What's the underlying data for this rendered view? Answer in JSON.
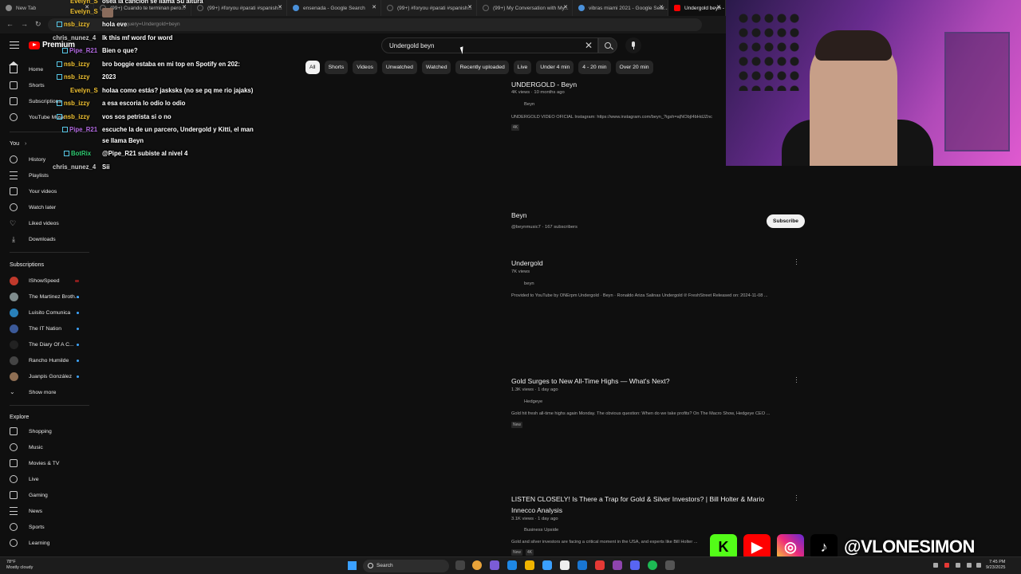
{
  "browser": {
    "tabs": [
      {
        "label": "New Tab",
        "favicon": "chrome-icon"
      },
      {
        "label": "(99+) Cuando te terminan pero...",
        "favicon": "tiktok-icon"
      },
      {
        "label": "(99+) #foryou #parati #spanish...",
        "favicon": "tiktok-icon"
      },
      {
        "label": "ensenada - Google Search",
        "favicon": "google-icon"
      },
      {
        "label": "(99+) #foryou #parati #spanish...",
        "favicon": "tiktok-icon"
      },
      {
        "label": "(99+) My Conversation with My...",
        "favicon": "tiktok-icon"
      },
      {
        "label": "vibras miami 2021 - Google Sear...",
        "favicon": "google-icon"
      },
      {
        "label": "Undergold beyn - YouTube",
        "favicon": "youtube-icon"
      }
    ],
    "url": "...h_query=Undergold+beyn"
  },
  "youtube": {
    "logo_text": "Premium",
    "search": {
      "query": "Undergold beyn"
    },
    "chips": [
      "All",
      "Shorts",
      "Videos",
      "Unwatched",
      "Watched",
      "Recently uploaded",
      "Live",
      "Under 4 min",
      "4 - 20 min",
      "Over 20 min"
    ],
    "sidebar": {
      "main": [
        {
          "label": "Home",
          "icon": "home-icon"
        },
        {
          "label": "Shorts",
          "icon": "shorts-icon"
        },
        {
          "label": "Subscriptions",
          "icon": "subscriptions-icon"
        },
        {
          "label": "YouTube Music",
          "icon": "youtube-music-icon"
        }
      ],
      "you_header": "You",
      "you": [
        {
          "label": "History",
          "icon": "history-icon"
        },
        {
          "label": "Playlists",
          "icon": "playlists-icon"
        },
        {
          "label": "Your videos",
          "icon": "your-videos-icon"
        },
        {
          "label": "Watch later",
          "icon": "watch-later-icon"
        },
        {
          "label": "Liked videos",
          "icon": "liked-icon"
        },
        {
          "label": "Downloads",
          "icon": "download-icon"
        }
      ],
      "subscriptions_header": "Subscriptions",
      "subscriptions": [
        {
          "label": "IShowSpeed",
          "color": "#c0392b"
        },
        {
          "label": "The Martinez Broth...",
          "color": "#7f8c8d"
        },
        {
          "label": "Luisito Comunica",
          "color": "#2980b9"
        },
        {
          "label": "The IT Nation",
          "color": "#3b5998"
        },
        {
          "label": "The Diary Of A C...",
          "color": "#222222"
        },
        {
          "label": "Rancho Humilde",
          "color": "#444444"
        },
        {
          "label": "Juanpis González",
          "color": "#8e6e53"
        }
      ],
      "show_more": "Show more",
      "explore_header": "Explore",
      "explore": [
        {
          "label": "Shopping",
          "icon": "shopping-icon"
        },
        {
          "label": "Music",
          "icon": "music-icon"
        },
        {
          "label": "Movies & TV",
          "icon": "movies-icon"
        },
        {
          "label": "Live",
          "icon": "live-icon"
        },
        {
          "label": "Gaming",
          "icon": "gaming-icon"
        },
        {
          "label": "News",
          "icon": "news-icon"
        },
        {
          "label": "Sports",
          "icon": "sports-icon"
        },
        {
          "label": "Learning",
          "icon": "learning-icon"
        }
      ]
    },
    "results": [
      {
        "title": "UNDERGOLD - Beyn",
        "meta": "4K views · 10 months ago",
        "channel": "Beyn",
        "desc": "UNDERGOLD VIDEO OFICIAL Instagram: https://www.instagram.com/beyn_?igsh=a|NObjI4bHdJZnc",
        "tag": "4K"
      },
      {
        "title": "Beyn",
        "meta": "@beynmusic7 · 167 subscribers",
        "subscribe_label": "Subscribe"
      },
      {
        "title": "Undergold",
        "meta": "7K views",
        "channel": "beyn",
        "desc": "Provided to YouTube by ONErpm Undergold · Beyn · Ronaldo Ariza Salinas Undergold ℗ FreshStreet Released on: 2024-11-08 ..."
      },
      {
        "title": "Gold Surges to New All-Time Highs — What's Next?",
        "meta": "1.3K views · 1 day ago",
        "channel": "Hedgeye",
        "desc": "Gold hit fresh all-time highs again Monday. The obvious question: When do we take profits? On The Macro Show, Hedgeye CEO ...",
        "tag": "New"
      },
      {
        "title": "LISTEN CLOSELY! Is There a Trap for Gold & Silver Investors? | Bill Holter & Mario",
        "title2": "Innecco Analysis",
        "meta": "3.1K views · 1 day ago",
        "channel": "Business Upside",
        "desc": "Gold and silver investors are facing a critical moment in the USA, and experts like Bill Holter ...",
        "tag": "New",
        "tag2": "4K"
      }
    ]
  },
  "chat": [
    {
      "user": "Evelyn_S",
      "text": "osea la cancion se llama Su altura",
      "color": "#f1c232"
    },
    {
      "user": "Evelyn_S",
      "text": "",
      "color": "#f1c232"
    },
    {
      "user": "nsb_izzy",
      "text": "hola eve",
      "color": "#f1c232"
    },
    {
      "user": "chris_nunez_4",
      "text": "lk this mf word for word",
      "color": "#cccccc"
    },
    {
      "user": "Pipe_R21",
      "text": "Bien o que?",
      "color": "#b36ae2"
    },
    {
      "user": "nsb_izzy",
      "text": "bro boggie estaba en mi top en Spotify en 202:",
      "color": "#f1c232"
    },
    {
      "user": "nsb_izzy",
      "text": "2023",
      "color": "#f1c232"
    },
    {
      "user": "Evelyn_S",
      "text": "holaa como estás? jasksks (no se pq me rio jajaks)",
      "color": "#f1c232"
    },
    {
      "user": "nsb_izzy",
      "text": "a esa escoria lo odio lo odio",
      "color": "#f1c232"
    },
    {
      "user": "nsb_izzy",
      "text": "vos sos petrista si o no",
      "color": "#f1c232"
    },
    {
      "user": "Pipe_R21",
      "text": "escuche la de un parcero, Undergold y Kitti, el man",
      "text2": "se llama Beyn",
      "color": "#b36ae2"
    },
    {
      "user": "BotRix",
      "text": "@Pipe_R21 subiste al nivel 4",
      "color": "#2ecc71"
    },
    {
      "user": "chris_nunez_4",
      "text": "Sii",
      "color": "#cccccc"
    }
  ],
  "overlay": {
    "handle": "@VLONESIMON",
    "socials": [
      "kick-icon",
      "youtube-icon",
      "instagram-icon",
      "tiktok-icon"
    ]
  },
  "taskbar": {
    "weather_temp": "78°F",
    "weather_desc": "Mostly cloudy",
    "search_label": "Search",
    "time": "7:45 PM",
    "date": "9/23/2025"
  }
}
